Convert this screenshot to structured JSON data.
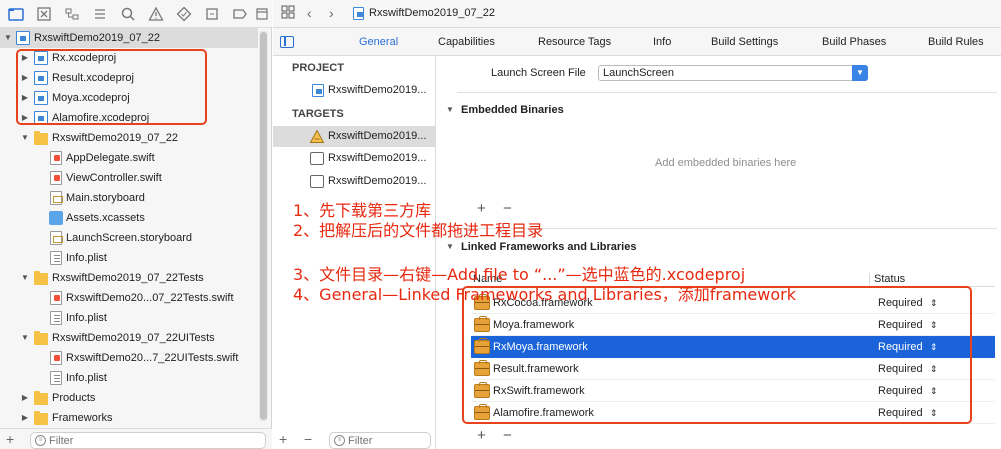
{
  "navigator": {
    "toolbar_icons": [
      "folder-icon",
      "source-control-icon",
      "hierarchy-icon",
      "search-icon",
      "warning-icon",
      "test-icon",
      "debug-icon",
      "breakpoint-icon",
      "report-icon"
    ],
    "items": [
      {
        "label": "RxswiftDemo2019_07_22",
        "icon": "project-icon"
      },
      {
        "label": "Rx.xcodeproj",
        "icon": "project-icon"
      },
      {
        "label": "Result.xcodeproj",
        "icon": "project-icon"
      },
      {
        "label": "Moya.xcodeproj",
        "icon": "project-icon"
      },
      {
        "label": "Alamofire.xcodeproj",
        "icon": "project-icon"
      },
      {
        "label": "RxswiftDemo2019_07_22",
        "icon": "folder-icon"
      },
      {
        "label": "AppDelegate.swift",
        "icon": "swift-file-icon"
      },
      {
        "label": "ViewController.swift",
        "icon": "swift-file-icon"
      },
      {
        "label": "Main.storyboard",
        "icon": "storyboard-icon"
      },
      {
        "label": "Assets.xcassets",
        "icon": "assets-icon"
      },
      {
        "label": "LaunchScreen.storyboard",
        "icon": "storyboard-icon"
      },
      {
        "label": "Info.plist",
        "icon": "plist-icon"
      },
      {
        "label": "RxswiftDemo2019_07_22Tests",
        "icon": "folder-icon"
      },
      {
        "label": "RxswiftDemo20...07_22Tests.swift",
        "icon": "swift-file-icon"
      },
      {
        "label": "Info.plist",
        "icon": "plist-icon"
      },
      {
        "label": "RxswiftDemo2019_07_22UITests",
        "icon": "folder-icon"
      },
      {
        "label": "RxswiftDemo20...7_22UITests.swift",
        "icon": "swift-file-icon"
      },
      {
        "label": "Info.plist",
        "icon": "plist-icon"
      },
      {
        "label": "Products",
        "icon": "folder-icon"
      },
      {
        "label": "Frameworks",
        "icon": "folder-icon"
      }
    ],
    "filter_placeholder": "Filter"
  },
  "jumpbar": {
    "file": "RxswiftDemo2019_07_22"
  },
  "tabs": [
    "General",
    "Capabilities",
    "Resource Tags",
    "Info",
    "Build Settings",
    "Build Phases",
    "Build Rules"
  ],
  "targets_panel": {
    "project_header": "PROJECT",
    "project_item": "RxswiftDemo2019...",
    "targets_header": "TARGETS",
    "targets": [
      "RxswiftDemo2019...",
      "RxswiftDemo2019...",
      "RxswiftDemo2019..."
    ],
    "filter_placeholder": "Filter"
  },
  "general": {
    "launch_screen_label": "Launch Screen File",
    "launch_screen_value": "LaunchScreen",
    "embedded_title": "Embedded Binaries",
    "embedded_hint": "Add embedded binaries here",
    "linked_title": "Linked Frameworks and Libraries",
    "col_name": "Name",
    "col_status": "Status",
    "frameworks": [
      {
        "name": "RxCocoa.framework",
        "status": "Required"
      },
      {
        "name": "Moya.framework",
        "status": "Required"
      },
      {
        "name": "RxMoya.framework",
        "status": "Required"
      },
      {
        "name": "Result.framework",
        "status": "Required"
      },
      {
        "name": "RxSwift.framework",
        "status": "Required"
      },
      {
        "name": "Alamofire.framework",
        "status": "Required"
      }
    ]
  },
  "annotations": [
    "1、先下载第三方库",
    "2、把解压后的文件都拖进工程目录",
    "3、文件目录—右键—Add file to “...”—选中蓝色的.xcodeproj",
    "4、General—Linked Frameworks and Libraries，添加framework"
  ],
  "colors": {
    "accent": "#2a6fd6",
    "selection": "#1a63d8",
    "annotation": "#e8280f"
  }
}
